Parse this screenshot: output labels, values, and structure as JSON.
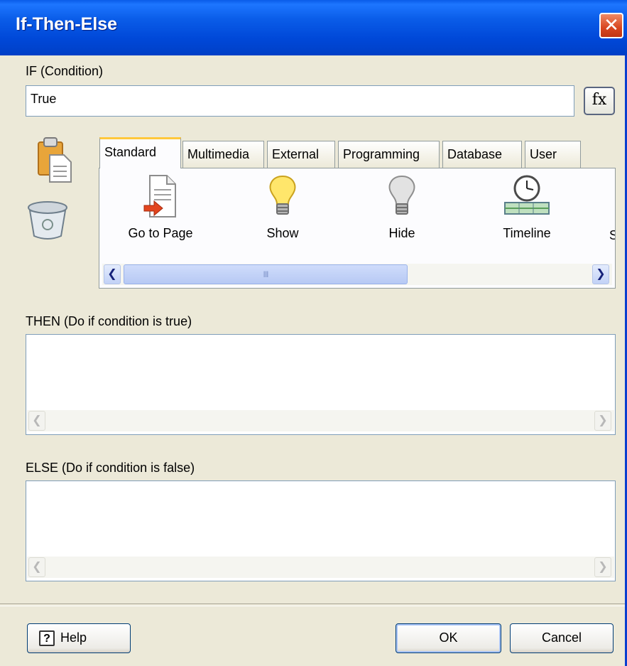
{
  "window": {
    "title": "If-Then-Else",
    "close_glyph": "✕"
  },
  "condition": {
    "label": "IF (Condition)",
    "value": "True",
    "fx_label": "fx"
  },
  "side_icons": [
    "paste-icon",
    "recycle-bin-icon"
  ],
  "tabs": [
    {
      "label": "Standard",
      "active": true
    },
    {
      "label": "Multimedia",
      "active": false
    },
    {
      "label": "External",
      "active": false
    },
    {
      "label": "Programming",
      "active": false
    },
    {
      "label": "Database",
      "active": false
    },
    {
      "label": "User",
      "active": false
    }
  ],
  "actions": [
    {
      "label": "Go to Page",
      "icon": "go-to-page-icon"
    },
    {
      "label": "Show",
      "icon": "lightbulb-on-icon"
    },
    {
      "label": "Hide",
      "icon": "lightbulb-off-icon"
    },
    {
      "label": "Timeline",
      "icon": "timeline-icon"
    },
    {
      "label": "S",
      "icon": ""
    }
  ],
  "scroll_grip": "III",
  "then": {
    "label": "THEN (Do if condition is true)"
  },
  "else": {
    "label": "ELSE (Do if condition is false)"
  },
  "buttons": {
    "help": "Help",
    "help_icon_glyph": "?",
    "ok": "OK",
    "cancel": "Cancel"
  },
  "colors": {
    "title_bar": "#0a5ce8",
    "active_tab_accent": "#ffc83c",
    "dialog_bg": "#ece9d8"
  }
}
